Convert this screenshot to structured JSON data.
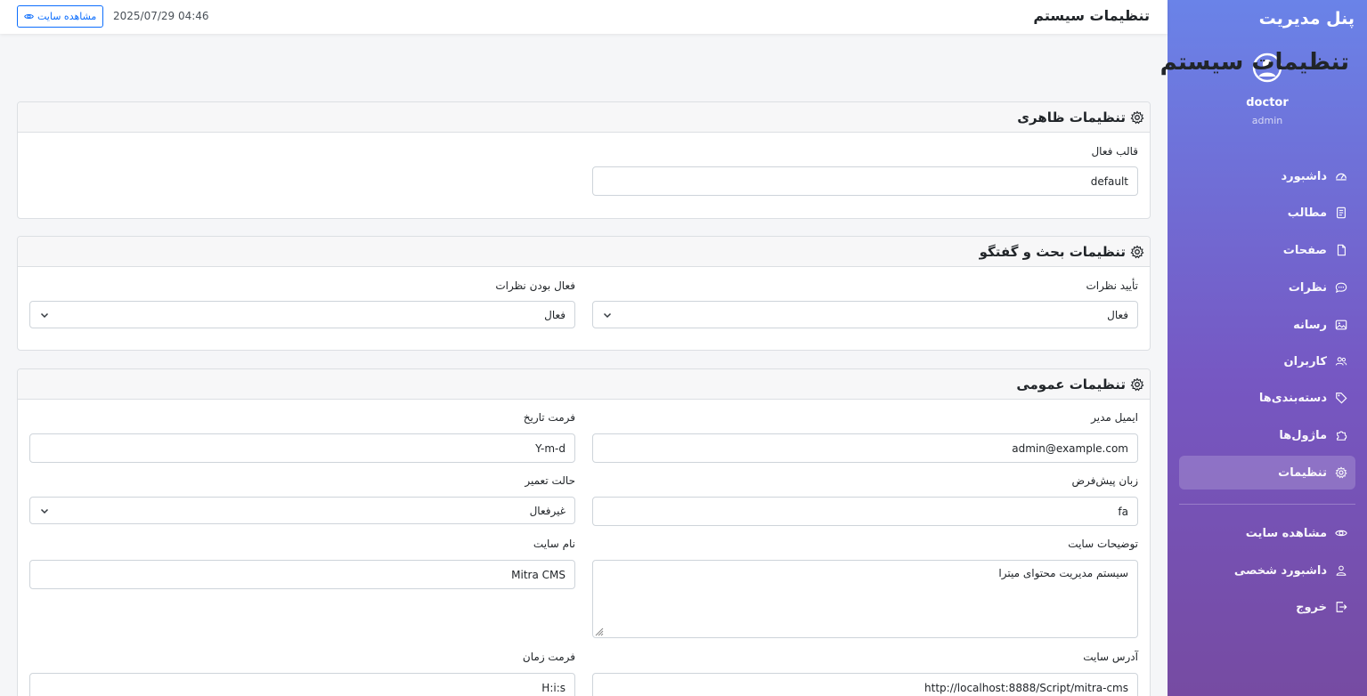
{
  "sidebar": {
    "brand": "پنل مدیریت",
    "user": {
      "name": "doctor",
      "role": "admin"
    },
    "items": [
      {
        "label": "داشبورد",
        "icon": "speedometer-icon"
      },
      {
        "label": "مطالب",
        "icon": "file-text-icon"
      },
      {
        "label": "صفحات",
        "icon": "file-icon"
      },
      {
        "label": "نظرات",
        "icon": "chat-icon"
      },
      {
        "label": "رسانه",
        "icon": "image-icon"
      },
      {
        "label": "کاربران",
        "icon": "people-icon"
      },
      {
        "label": "دسته‌بندی‌ها",
        "icon": "tag-icon"
      },
      {
        "label": "ماژول‌ها",
        "icon": "puzzle-icon"
      },
      {
        "label": "تنظیمات",
        "icon": "gear-icon",
        "active": true
      }
    ],
    "bottom_items": [
      {
        "label": "مشاهده سایت",
        "icon": "eye-icon"
      },
      {
        "label": "داشبورد شخصی",
        "icon": "person-icon"
      },
      {
        "label": "خروج",
        "icon": "logout-icon"
      }
    ]
  },
  "header": {
    "title": "تنظیمات سیستم",
    "datetime": "2025/07/29 04:46",
    "view_site_label": "مشاهده سایت"
  },
  "main": {
    "page_title": "تنظیمات سیستم",
    "appearance": {
      "title": "تنظیمات ظاهری",
      "theme_label": "قالب فعال",
      "theme_value": "default"
    },
    "discussion": {
      "title": "تنظیمات بحث و گفتگو",
      "approve_label": "تأیید نظرات",
      "approve_value": "فعال",
      "enabled_label": "فعال بودن نظرات",
      "enabled_value": "فعال"
    },
    "general": {
      "title": "تنظیمات عمومی",
      "admin_email_label": "ایمیل مدیر",
      "admin_email_value": "admin@example.com",
      "date_format_label": "فرمت تاریخ",
      "date_format_value": "Y-m-d",
      "language_label": "زبان پیش‌فرض",
      "language_value": "fa",
      "maintenance_label": "حالت تعمیر",
      "maintenance_value": "غیرفعال",
      "description_label": "توضیحات سایت",
      "description_value": "سیستم مدیریت محتوای میترا",
      "site_name_label": "نام سایت",
      "site_name_value": "Mitra CMS",
      "site_url_label": "آدرس سایت",
      "site_url_value": "http://localhost:8888/Script/mitra-cms",
      "time_format_label": "فرمت زمان",
      "time_format_value": "H:i:s"
    }
  }
}
